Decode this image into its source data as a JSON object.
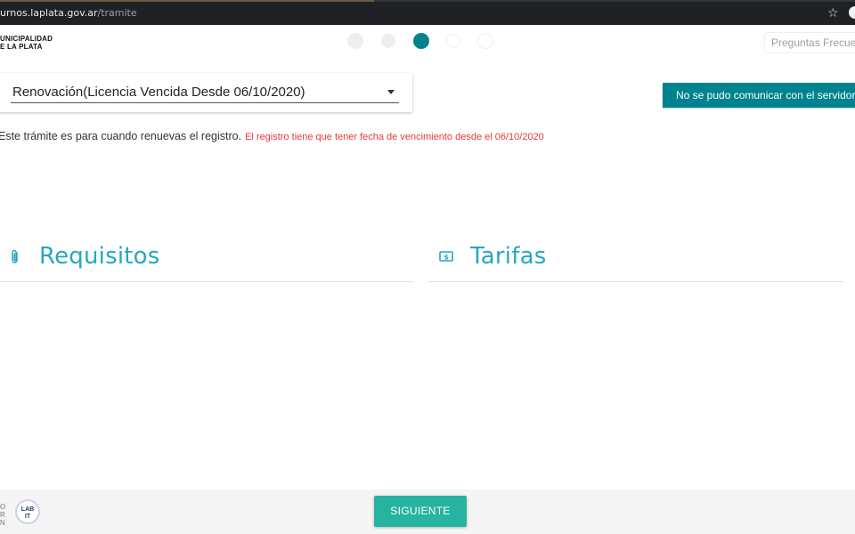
{
  "browser": {
    "url_host": "urnos.laplata.gov.ar",
    "url_path": "/tramite",
    "star_icon": "star-outline-icon",
    "profile_icon": "profile-avatar-icon"
  },
  "header": {
    "logo_line1": "UNICIPALIDAD",
    "logo_line2": "E LA PLATA",
    "steps": [
      {
        "state": "done"
      },
      {
        "state": "done"
      },
      {
        "state": "active"
      },
      {
        "state": "pending"
      },
      {
        "state": "pending"
      }
    ],
    "faq_label": "Preguntas Frecue"
  },
  "form": {
    "selected_tramite": "Renovación(Licencia Vencida Desde 06/10/2020)",
    "caret_icon": "dropdown-caret-icon",
    "info_text": "Este trámite es para cuando renuevas el registro.",
    "warning_text": "El registro tiene que tener fecha de vencimiento desde el 06/10/2020"
  },
  "alert": {
    "message": "No se pudo comunicar con el servidor"
  },
  "sections": {
    "requisitos": {
      "title": "Requisitos",
      "icon": "paperclip-icon"
    },
    "tarifas": {
      "title": "Tarifas",
      "icon": "money-bill-icon"
    }
  },
  "footer": {
    "side_text_1": "O",
    "side_text_2": "R",
    "side_text_3": "N",
    "labit_line1": "LAB",
    "labit_line2": "IT",
    "next_label": "SIGUIENTE"
  },
  "colors": {
    "accent": "#00838f",
    "section_title": "#26a7c0",
    "warning": "#e53935",
    "button": "#26b3a0"
  }
}
